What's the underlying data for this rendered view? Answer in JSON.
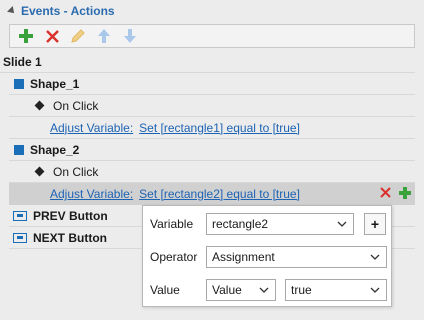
{
  "panel": {
    "title": "Events - Actions"
  },
  "toolbar": {
    "add": "add-icon",
    "delete": "delete-icon",
    "edit": "edit-icon",
    "move_up": "arrow-up-icon",
    "move_down": "arrow-down-icon"
  },
  "tree": {
    "slide_label": "Slide 1",
    "items": [
      {
        "name": "Shape_1",
        "event": "On Click",
        "action_type": "Adjust Variable:",
        "action_value": "Set [rectangle1] equal to [true]"
      },
      {
        "name": "Shape_2",
        "event": "On Click",
        "action_type": "Adjust Variable:",
        "action_value": "Set [rectangle2] equal to [true]"
      }
    ],
    "buttons": [
      "PREV Button",
      "NEXT Button"
    ]
  },
  "popup": {
    "variable_label": "Variable",
    "variable_value": "rectangle2",
    "add_label": "+",
    "operator_label": "Operator",
    "operator_value": "Assignment",
    "value_label": "Value",
    "value_type": "Value",
    "value_value": "true"
  },
  "colors": {
    "accent": "#2b6bb0",
    "link": "#1d63b4",
    "add_green": "#3aa23a",
    "delete_red": "#d9302c",
    "shape_blue": "#1a6fb8"
  }
}
